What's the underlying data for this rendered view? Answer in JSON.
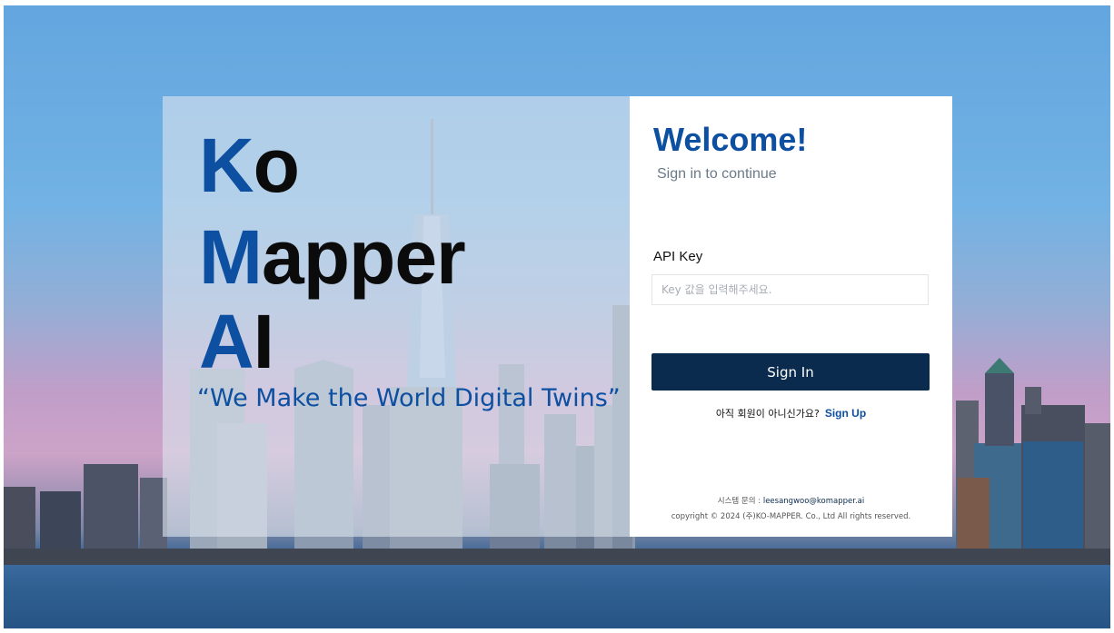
{
  "brand": {
    "line1": {
      "accent": "K",
      "rest": "o"
    },
    "line2": {
      "accent": "M",
      "rest": "apper"
    },
    "line3": {
      "accent": "A",
      "rest": "I"
    },
    "slogan": "“We Make the World Digital Twins”"
  },
  "login": {
    "title": "Welcome!",
    "subtitle": "Sign in to continue",
    "api_key_label": "API Key",
    "api_key_placeholder": "Key 값을 입력해주세요.",
    "api_key_value": "",
    "sign_in_label": "Sign In",
    "signup_prompt": "아직 회원이 아니신가요?",
    "signup_link": "Sign Up"
  },
  "footer": {
    "contact_label": "시스템 문의 :",
    "contact_email": "leesangwoo@komapper.ai",
    "copyright": "copyright © 2024 (주)KO-MAPPER. Co., Ltd All rights reserved."
  },
  "colors": {
    "accent": "#0d4fa0",
    "button": "#0b2b4e"
  }
}
